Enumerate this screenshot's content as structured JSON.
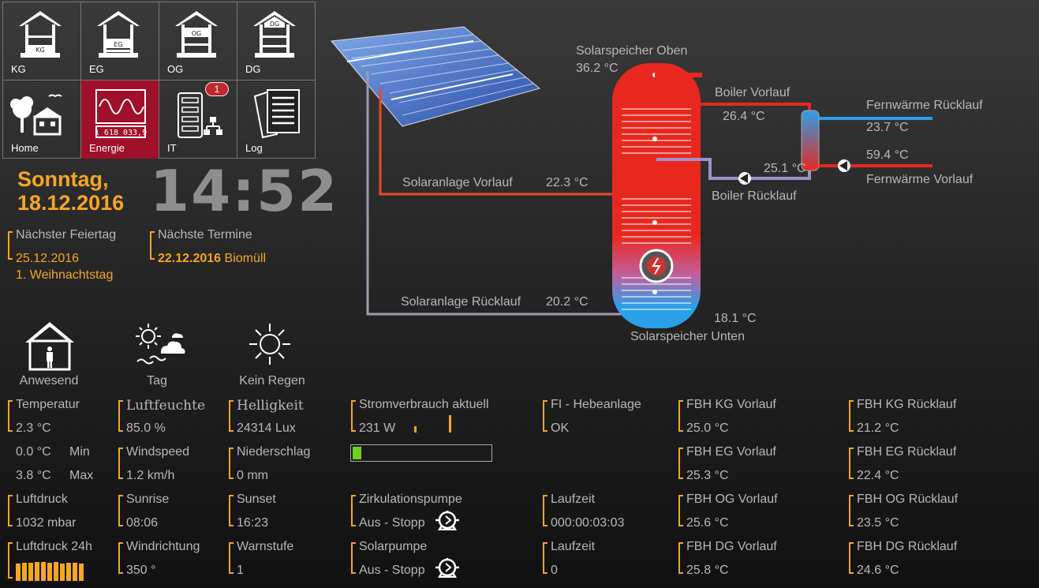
{
  "nav": {
    "tiles": [
      {
        "label": "KG",
        "icon_text": "KG"
      },
      {
        "label": "EG",
        "icon_text": "EG"
      },
      {
        "label": "OG",
        "icon_text": "OG"
      },
      {
        "label": "DG",
        "icon_text": "DG"
      },
      {
        "label": "Home"
      },
      {
        "label": "Energie",
        "meter": "1 618 033,9"
      },
      {
        "label": "IT",
        "badge": "1"
      },
      {
        "label": "Log"
      }
    ],
    "active_color": "#a0102a"
  },
  "datetime": {
    "day": "Sonntag,",
    "date": "18.12.2016",
    "time": "14:52"
  },
  "holiday": {
    "label": "Nächster Feiertag",
    "date": "25.12.2016",
    "name": "1. Weihnachtstag"
  },
  "appointments": {
    "label": "Nächste Termine",
    "date": "22.12.2016",
    "name": "Biomüll"
  },
  "status_icons": [
    {
      "icon": "house-person-icon",
      "label": "Anwesend"
    },
    {
      "icon": "sun-cloud-icon",
      "label": "Tag"
    },
    {
      "icon": "sun-icon",
      "label": "Kein Regen"
    }
  ],
  "diagram": {
    "solar_top_label": "Solarspeicher Oben",
    "solar_top_value": "36.2 °C",
    "boiler_flow_label": "Boiler Vorlauf",
    "boiler_flow_value": "26.4 °C",
    "district_return_label": "Fernwärme Rücklauf",
    "district_return_value": "23.7 °C",
    "district_flow_value": "59.4 °C",
    "district_flow_label": "Fernwärme Vorlauf",
    "exchanger_value": "25.1 °C",
    "boiler_return_label": "Boiler Rücklauf",
    "solar_flow_label": "Solaranlage Vorlauf",
    "solar_flow_value": "22.3 °C",
    "solar_return_label": "Solaranlage Rücklauf",
    "solar_return_value": "20.2 °C",
    "solar_bottom_value": "18.1 °C",
    "solar_bottom_label": "Solarspeicher Unten"
  },
  "weather": {
    "temperature": {
      "label": "Temperatur",
      "value": "2.3 °C",
      "min_value": "0.0 °C",
      "min_label": "Min",
      "max_value": "3.8 °C",
      "max_label": "Max"
    },
    "humidity": {
      "label": "Luftfeuchte",
      "value": "85.0 %"
    },
    "brightness": {
      "label": "Helligkeit",
      "value": "24314 Lux"
    },
    "windspeed": {
      "label": "Windspeed",
      "value": "1.2 km/h"
    },
    "precipitation": {
      "label": "Niederschlag",
      "value": "0 mm"
    },
    "pressure": {
      "label": "Luftdruck",
      "value": "1032 mbar"
    },
    "sunrise": {
      "label": "Sunrise",
      "value": "08:06"
    },
    "sunset": {
      "label": "Sunset",
      "value": "16:23"
    },
    "pressure24": {
      "label": "Luftdruck 24h"
    },
    "winddir": {
      "label": "Windrichtung",
      "value": "350 °"
    },
    "warning": {
      "label": "Warnstufe",
      "value": "1"
    }
  },
  "power": {
    "label": "Stromverbrauch aktuell",
    "value": "231 W",
    "bar_fraction": 0.06
  },
  "fi": {
    "label": "FI - Hebeanlage",
    "value": "OK"
  },
  "pumps": [
    {
      "label": "Zirkulationspumpe",
      "value": "Aus - Stopp",
      "runtime_label": "Laufzeit",
      "runtime_value": "000:00:03:03"
    },
    {
      "label": "Solarpumpe",
      "value": "Aus - Stopp",
      "runtime_label": "Laufzeit",
      "runtime_value": "0"
    }
  ],
  "fbh": [
    {
      "flow_label": "FBH KG Vorlauf",
      "flow_value": "25.0 °C",
      "ret_label": "FBH KG Rücklauf",
      "ret_value": "21.2 °C"
    },
    {
      "flow_label": "FBH EG Vorlauf",
      "flow_value": "25.3 °C",
      "ret_label": "FBH EG Rücklauf",
      "ret_value": "22.4 °C"
    },
    {
      "flow_label": "FBH OG Vorlauf",
      "flow_value": "25.6 °C",
      "ret_label": "FBH OG Rücklauf",
      "ret_value": "23.5 °C"
    },
    {
      "flow_label": "FBH DG Vorlauf",
      "flow_value": "25.8 °C",
      "ret_label": "FBH DG Rücklauf",
      "ret_value": "24.6 °C"
    }
  ],
  "colors": {
    "accent": "#f5a623",
    "hot": "#e8281e",
    "cold": "#2aa0e8",
    "power_bar": "#6fd21f"
  }
}
